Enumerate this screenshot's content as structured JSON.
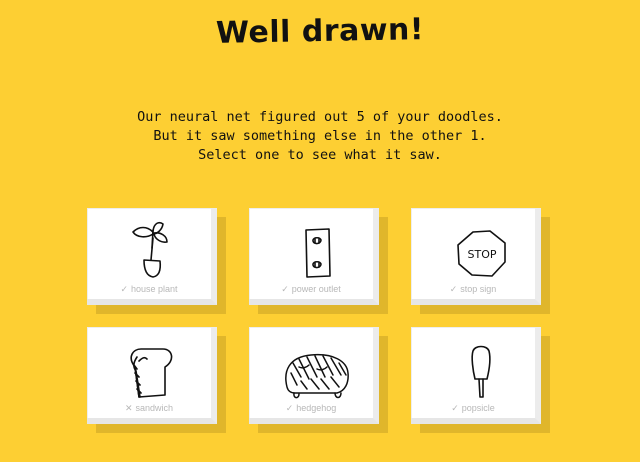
{
  "header": {
    "title": "Well drawn!"
  },
  "message": {
    "line1": "Our neural net figured out 5 of your doodles.",
    "line2": "But it saw something else in the other 1.",
    "line3": "Select one to see what it saw."
  },
  "doodles": [
    {
      "label": "house plant",
      "mark": "✓",
      "correct": true
    },
    {
      "label": "power outlet",
      "mark": "✓",
      "correct": true
    },
    {
      "label": "stop sign",
      "mark": "✓",
      "correct": true
    },
    {
      "label": "sandwich",
      "mark": "✕",
      "correct": false
    },
    {
      "label": "hedgehog",
      "mark": "✓",
      "correct": true
    },
    {
      "label": "popsicle",
      "mark": "✓",
      "correct": true
    }
  ],
  "stop_sign_text": "STOP",
  "colors": {
    "background": "#FDCF33",
    "card_shadow": "#E0B62B",
    "label": "#b8b8b8"
  }
}
